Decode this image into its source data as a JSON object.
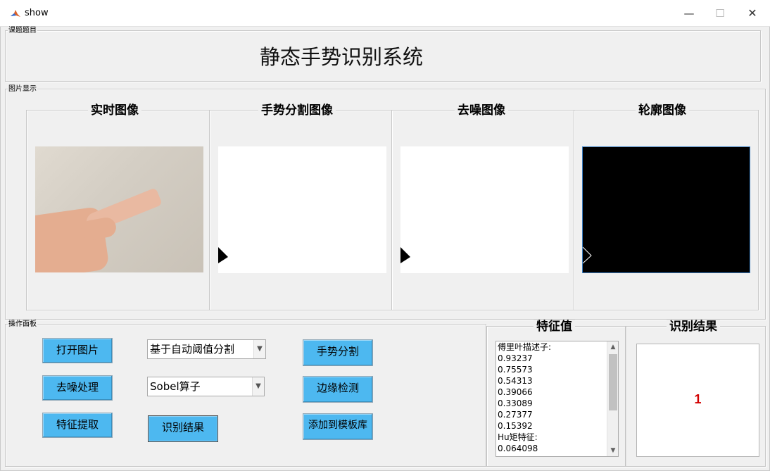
{
  "window": {
    "title": "show",
    "minimize": "—",
    "maximize": "☐",
    "close": "✕"
  },
  "title_panel": {
    "label": "课题题目",
    "title": "静态手势识别系统"
  },
  "image_panel": {
    "label": "图片显示",
    "panels": [
      {
        "title": "实时图像"
      },
      {
        "title": "手势分割图像"
      },
      {
        "title": "去噪图像"
      },
      {
        "title": "轮廓图像"
      }
    ]
  },
  "operation_panel": {
    "label": "操作面板",
    "buttons": {
      "open_image": "打开图片",
      "denoise": "去噪处理",
      "feature_extract": "特征提取",
      "recognize": "识别结果",
      "segment": "手势分割",
      "edge_detect": "边缘检测",
      "add_template": "添加到模板库"
    },
    "segmentation_method": {
      "selected": "基于自动阈值分割"
    },
    "edge_operator": {
      "selected": "Sobel算子"
    }
  },
  "feature_panel": {
    "title": "特征值",
    "lines": [
      "傅里叶描述子:",
      "0.93237",
      "0.75573",
      "0.54313",
      "0.39066",
      "0.33089",
      "0.27377",
      "0.15392",
      "Hu矩特征:",
      "0.064098"
    ]
  },
  "result_panel": {
    "title": "识别结果",
    "value": "1"
  },
  "colors": {
    "button": "#4db8f0",
    "result": "#d20000"
  }
}
